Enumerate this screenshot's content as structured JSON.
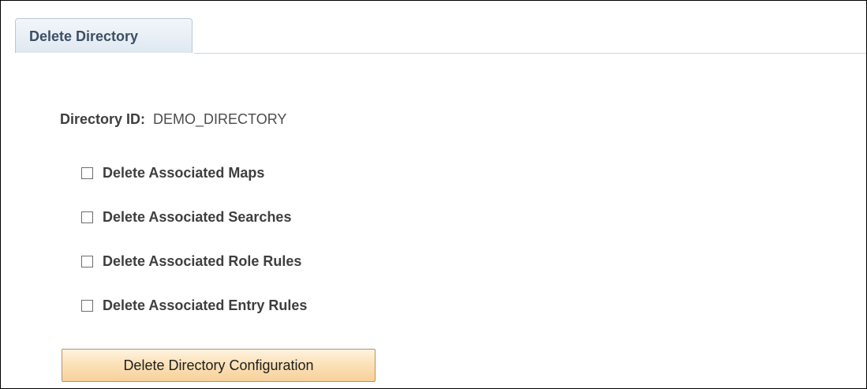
{
  "tabs": [
    {
      "label": "Delete Directory",
      "active": true
    }
  ],
  "directory": {
    "label": "Directory ID:",
    "value": "DEMO_DIRECTORY"
  },
  "options": [
    {
      "label": "Delete Associated Maps",
      "checked": false
    },
    {
      "label": "Delete Associated Searches",
      "checked": false
    },
    {
      "label": "Delete Associated Role Rules",
      "checked": false
    },
    {
      "label": "Delete Associated Entry Rules",
      "checked": false
    }
  ],
  "actions": {
    "delete_configuration_label": "Delete Directory Configuration"
  },
  "colors": {
    "tab_background": "#dfe8f1",
    "tab_text": "#3c4f64",
    "button_background": "#fbe2b9",
    "button_border": "#b3936a"
  }
}
